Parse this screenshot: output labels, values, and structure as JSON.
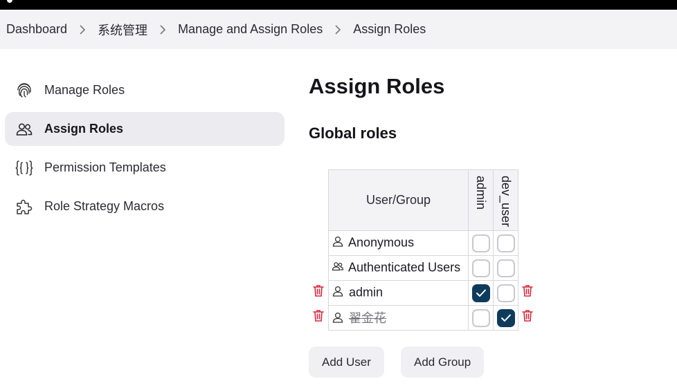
{
  "breadcrumb": [
    "Dashboard",
    "系统管理",
    "Manage and Assign Roles",
    "Assign Roles"
  ],
  "sidebar": {
    "items": [
      {
        "label": "Manage Roles",
        "icon": "fingerprint-icon",
        "active": false
      },
      {
        "label": "Assign Roles",
        "icon": "users-icon",
        "active": true
      },
      {
        "label": "Permission Templates",
        "icon": "braces-icon",
        "active": false
      },
      {
        "label": "Role Strategy Macros",
        "icon": "puzzle-icon",
        "active": false
      }
    ]
  },
  "main": {
    "title": "Assign Roles",
    "section_title": "Global roles",
    "table": {
      "header_usergroup": "User/Group",
      "roles": [
        "admin",
        "dev_user"
      ],
      "rows": [
        {
          "name": "Anonymous",
          "type": "user",
          "admin": false,
          "dev_user": false,
          "deletable": false,
          "strikethrough": false
        },
        {
          "name": "Authenticated Users",
          "type": "group",
          "admin": false,
          "dev_user": false,
          "deletable": false,
          "strikethrough": false
        },
        {
          "name": "admin",
          "type": "user",
          "admin": true,
          "dev_user": false,
          "deletable": true,
          "strikethrough": false
        },
        {
          "name": "翟金花",
          "type": "user",
          "admin": false,
          "dev_user": true,
          "deletable": true,
          "strikethrough": true
        }
      ]
    },
    "buttons": {
      "add_user": "Add User",
      "add_group": "Add Group"
    }
  },
  "colors": {
    "checked": "#0e3b5c",
    "trash": "#d6293e",
    "active_bg": "#ebebf0",
    "breadcrumb_bg": "#f3f3f6"
  }
}
